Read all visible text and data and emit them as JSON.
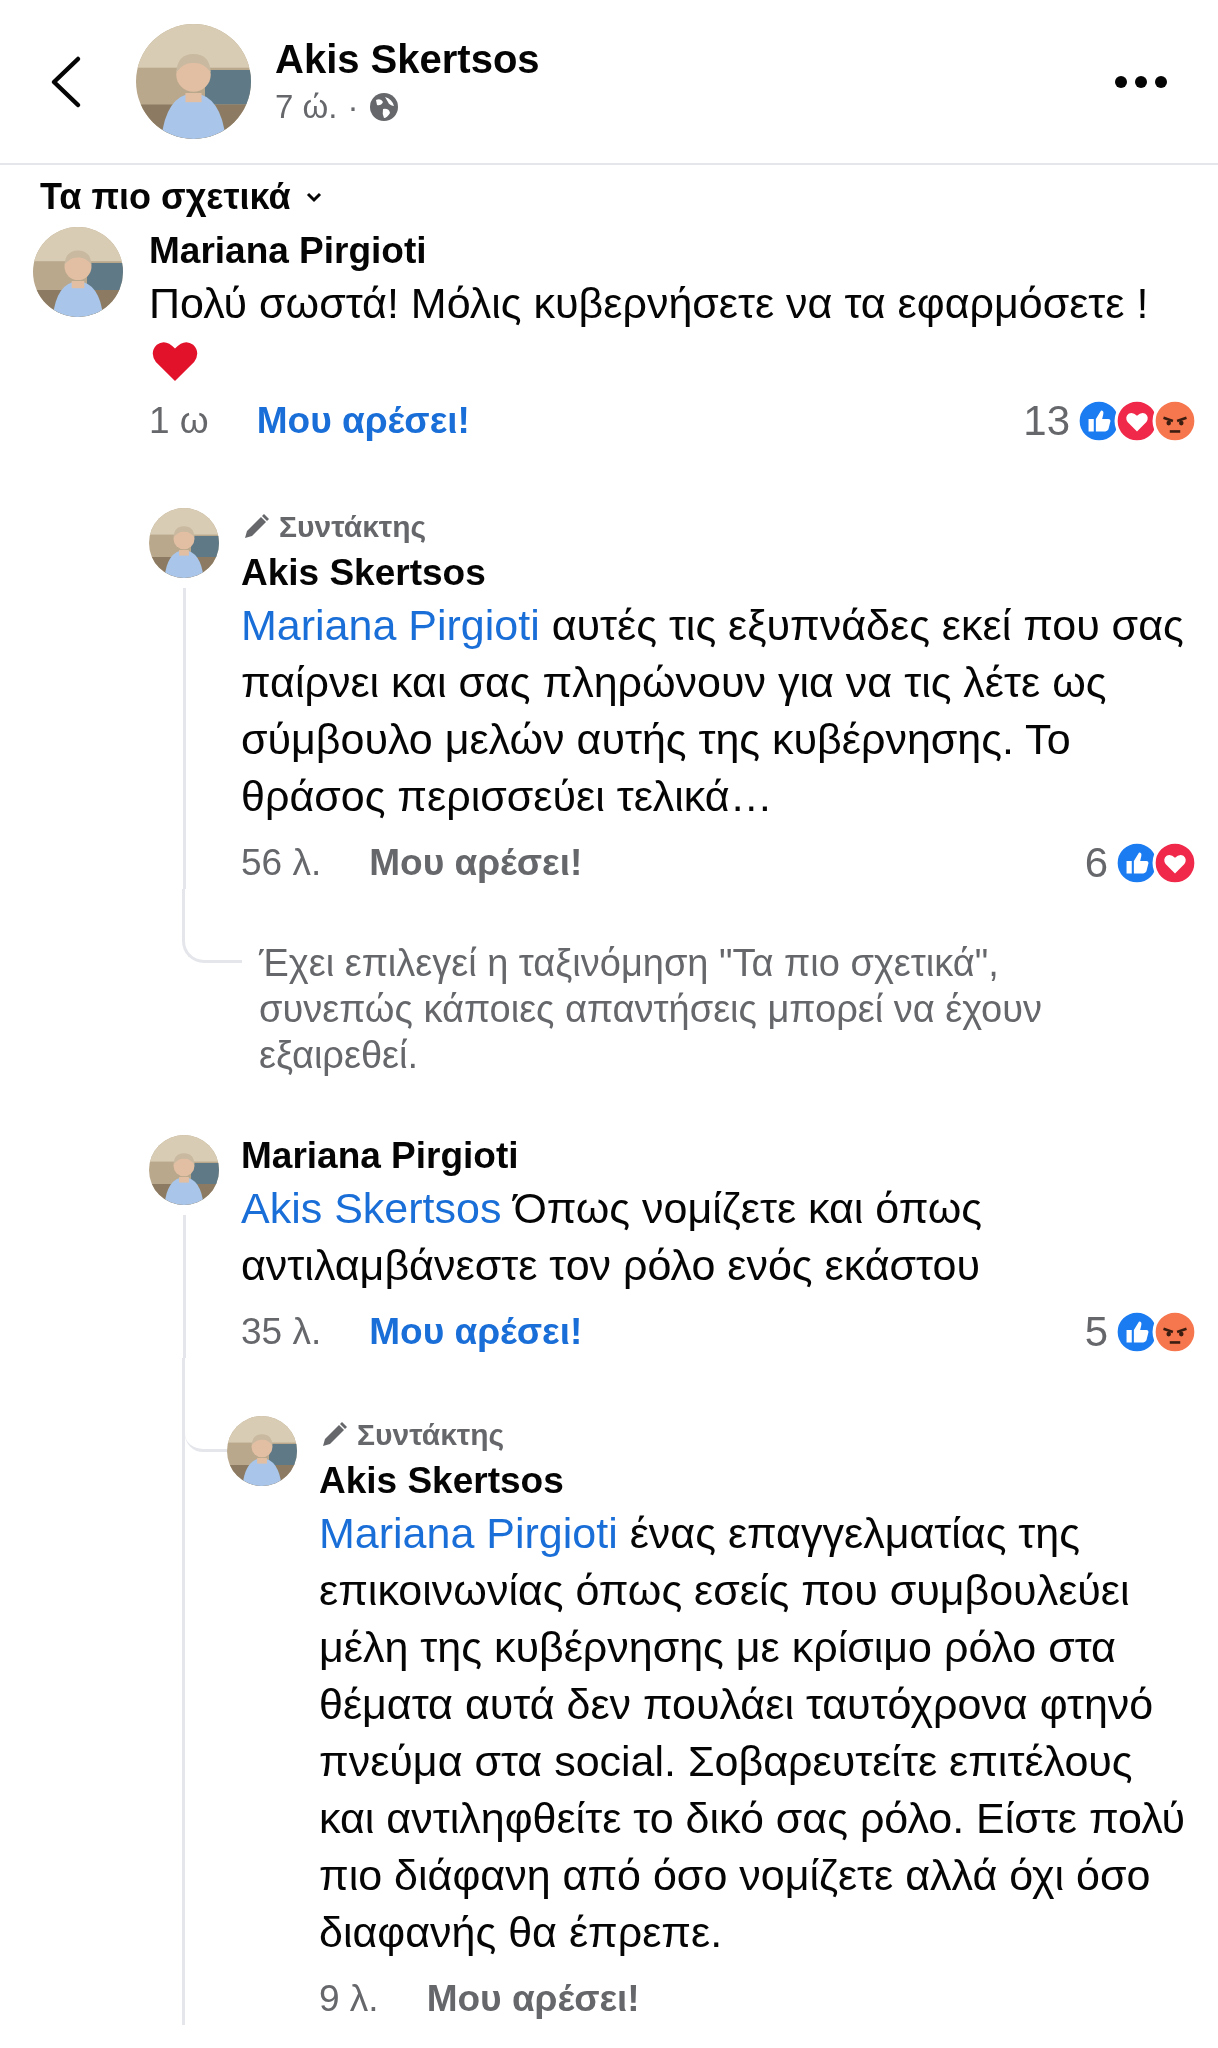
{
  "header": {
    "title": "Akis Skertsos",
    "time": "7 ώ.",
    "separator": "·"
  },
  "sort_label": "Τα πιο σχετικά",
  "comments": [
    {
      "author": "Mariana Pirgioti",
      "text": "Πολύ σωστά! Μόλις κυβερνήσετε να τα εφαρμόσετε !",
      "attachment": {
        "kind": "heart"
      },
      "time": "1 ω",
      "like_label": "Μου αρέσει!",
      "liked": true,
      "reaction_count": "13",
      "reactions": [
        {
          "kind": "like"
        },
        {
          "kind": "love"
        },
        {
          "kind": "angry"
        }
      ],
      "replies": [
        {
          "kind": "comment",
          "badge": "Συντάκτης",
          "author": "Akis Skertsos",
          "mention": "Mariana Pirgioti",
          "text": "αυτές τις εξυπνάδες εκεί που σας παίρνει και σας πληρώνουν για να τις λέτε ως σύμβουλο μελών αυτής της κυβέρνησης. Το θράσος περισσεύει τελικά…",
          "time": "56 λ.",
          "like_label": "Μου αρέσει!",
          "liked": false,
          "reaction_count": "6",
          "reactions": [
            {
              "kind": "like"
            },
            {
              "kind": "love"
            }
          ]
        },
        {
          "kind": "notice",
          "text": "Έχει επιλεγεί η ταξινόμηση \"Τα πιο σχετικά\", συνεπώς κάποιες απαντήσεις μπορεί να έχουν εξαιρεθεί."
        },
        {
          "kind": "comment",
          "author": "Mariana Pirgioti",
          "mention": "Akis Skertsos",
          "text": "Όπως νομίζετε και όπως αντιλαμβάνεστε τον ρόλο ενός εκάστου",
          "time": "35 λ.",
          "like_label": "Μου αρέσει!",
          "liked": true,
          "reaction_count": "5",
          "reactions": [
            {
              "kind": "like"
            },
            {
              "kind": "angry"
            }
          ],
          "replies": [
            {
              "kind": "comment",
              "badge": "Συντάκτης",
              "author": "Akis Skertsos",
              "mention": "Mariana Pirgioti",
              "text": "ένας επαγγελματίας της επικοινωνίας όπως εσείς που συμβουλεύει μέλη της κυβέρνησης με κρίσιμο ρόλο στα θέματα αυτά δεν πουλάει ταυτόχρονα φτηνό πνεύμα στα social. Σοβαρευτείτε επιτέλους και αντιληφθείτε το δικό σας ρόλο. Είστε πολύ πιο διάφανη από όσο νομίζετε αλλά όχι όσο διαφανής θα έπρεπε.",
              "time": "9 λ.",
              "like_label": "Μου αρέσει!",
              "liked": false
            }
          ]
        }
      ]
    }
  ]
}
